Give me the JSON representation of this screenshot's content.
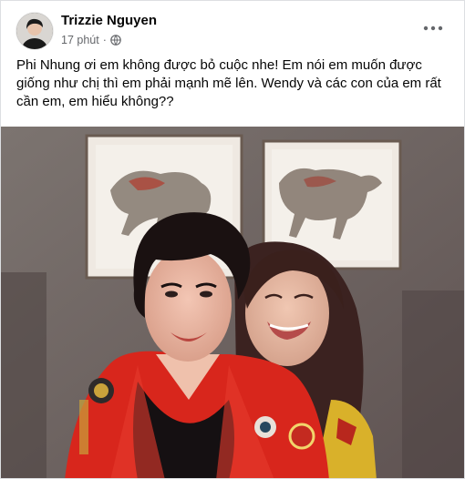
{
  "post": {
    "author_name": "Trizzie Nguyen",
    "time_ago": "17 phút",
    "separator": "·",
    "privacy_icon": "globe-icon",
    "more_icon": "more-options-icon",
    "text_lines": [
      "Phi Nhung ơi em không được bỏ cuộc nhe!  Em nói em muốn được",
      "giống như chị thì em phải mạnh mẽ lên.  Wendy và các con của em rất",
      "cần em, em hiểu không??"
    ]
  },
  "colors": {
    "secondary_text": "#65676b",
    "primary_text": "#050505",
    "jacket_red": "#d8261c"
  }
}
